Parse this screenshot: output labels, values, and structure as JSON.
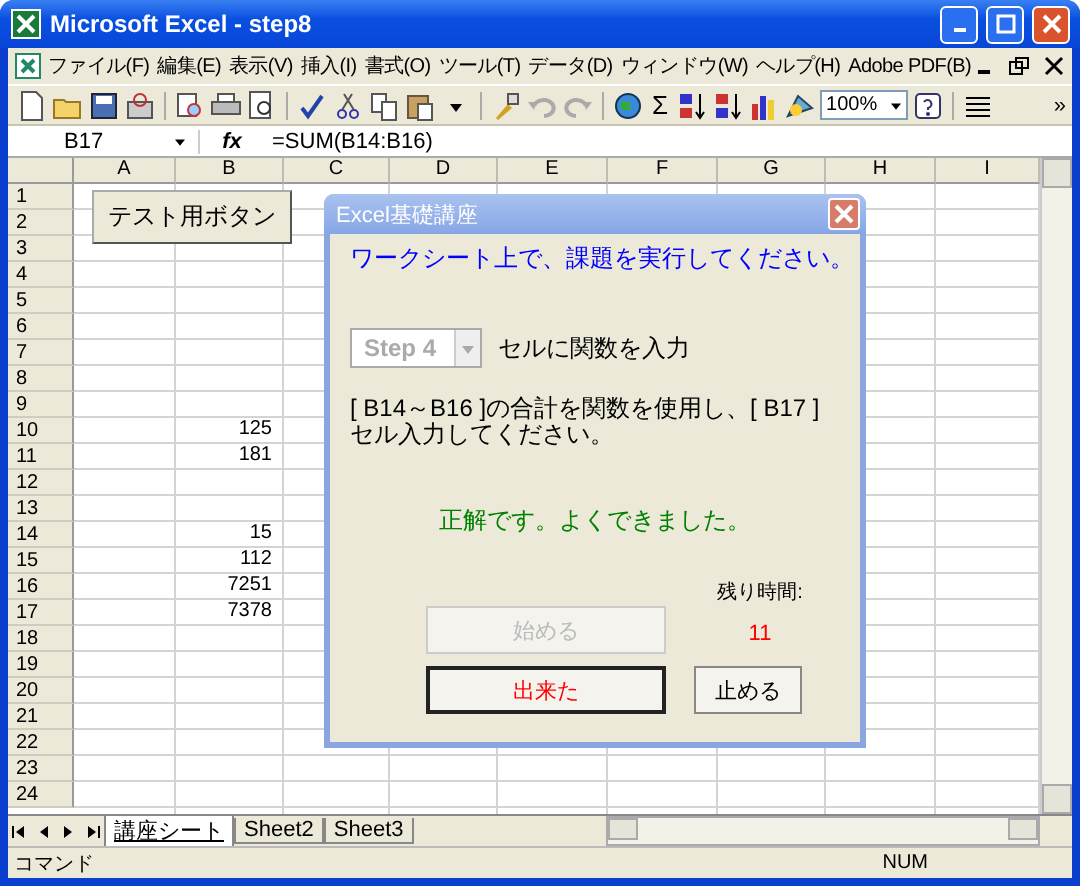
{
  "window": {
    "title": "Microsoft Excel - step8"
  },
  "menu": [
    "ファイル(F)",
    "編集(E)",
    "表示(V)",
    "挿入(I)",
    "書式(O)",
    "ツール(T)",
    "データ(D)",
    "ウィンドウ(W)",
    "ヘルプ(H)",
    "Adobe PDF(B)"
  ],
  "toolbar": {
    "sum": "Σ",
    "zoom": "100%",
    "overflow": "»"
  },
  "formula_bar": {
    "name_box": "B17",
    "function_label": "fx",
    "formula": "=SUM(B14:B16)"
  },
  "columns": [
    "A",
    "B",
    "C",
    "D",
    "E",
    "F",
    "G",
    "H",
    "I"
  ],
  "rows": [
    {
      "label": "1"
    },
    {
      "label": "2"
    },
    {
      "label": "3"
    },
    {
      "label": "4"
    },
    {
      "label": "5"
    },
    {
      "label": "6"
    },
    {
      "label": "7"
    },
    {
      "label": "8"
    },
    {
      "label": "9"
    },
    {
      "label": "10",
      "B": "125"
    },
    {
      "label": "11",
      "B": "181"
    },
    {
      "label": "12"
    },
    {
      "label": "13"
    },
    {
      "label": "14",
      "B": "15"
    },
    {
      "label": "15",
      "B": "112"
    },
    {
      "label": "16",
      "B": "7251"
    },
    {
      "label": "17",
      "B": "7378"
    },
    {
      "label": "18"
    },
    {
      "label": "19"
    },
    {
      "label": "20"
    },
    {
      "label": "21"
    },
    {
      "label": "22"
    },
    {
      "label": "23"
    },
    {
      "label": "24"
    }
  ],
  "sheet_button": "テスト用ボタン",
  "sheet_tabs": [
    {
      "label": "講座シート",
      "selected": true
    },
    {
      "label": "Sheet2",
      "selected": false
    },
    {
      "label": "Sheet3",
      "selected": false
    }
  ],
  "status_bar": {
    "mode": "コマンド",
    "num": "NUM"
  },
  "dialog": {
    "title": "Excel基礎講座",
    "instruction": "ワークシート上で、課題を実行してください。",
    "step": {
      "value": "Step 4",
      "disabled": true
    },
    "step_label": "セルに関数を入力",
    "task": "[ B14～B16 ]の合計を関数を使用し、[ B17 ] セル入力してください。",
    "result": "正解です。よくできました。",
    "timer_label": "残り時間:",
    "timer_value": "11",
    "buttons": [
      {
        "label": "始める",
        "disabled": true,
        "default": false
      },
      {
        "label": "出来た",
        "disabled": false,
        "default": true,
        "color": "#ff0000"
      },
      {
        "label": "止める",
        "disabled": false,
        "default": false,
        "color": "#000000"
      }
    ]
  }
}
